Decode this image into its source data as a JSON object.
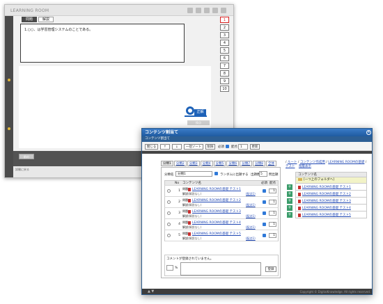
{
  "background_window": {
    "logo": "LEARNING ROOM",
    "tabs": [
      {
        "label": "問題"
      },
      {
        "label": "解説"
      }
    ],
    "question_text": "1.○○、は学習管理システムのことである。",
    "numbers": [
      "1",
      "2",
      "3",
      "4",
      "5",
      "6",
      "7",
      "8",
      "9",
      "10"
    ],
    "answer_label": "正解",
    "mark_label": "採点",
    "next_label": "正一",
    "prev_button": "前の",
    "status_text": "試験に戻る"
  },
  "dialog": {
    "title": "コンテンツ割当て",
    "subtitle": "コンテンツ割当て",
    "close": "×",
    "toolbar": {
      "save": "閉じる",
      "up": "↑",
      "down": "↓",
      "batch_sort": "一括ソート",
      "delete": "削除",
      "required_label": "必須",
      "score_label": "配点",
      "score_value": "1",
      "apply": "更新"
    },
    "tabs": [
      "分類1",
      "分類2",
      "分類3",
      "分類4",
      "分類5",
      "分類6",
      "分類7",
      "分類8",
      "全体"
    ],
    "controls": {
      "name_label": "分類名",
      "name_value": "分類1",
      "random_label": "ランダムに出題する",
      "count_label": "出題数",
      "count_value": "5",
      "count_suffix": "問出題"
    },
    "table": {
      "headers": {
        "no": "No",
        "contents": "コンテンツ名",
        "required": "必須",
        "score": "配点"
      },
      "rows": [
        {
          "no": "1",
          "q_badge": "問題",
          "k_badge": "解説",
          "title": "LEARNING ROOMの基礎 テスト1",
          "none": "(解説なし)",
          "edit": "(配点1)",
          "score": "1"
        },
        {
          "no": "2",
          "q_badge": "問題",
          "k_badge": "解説",
          "title": "LEARNING ROOMの基礎 テスト2",
          "none": "(解説なし)",
          "edit": "(配点1)",
          "score": "1"
        },
        {
          "no": "3",
          "q_badge": "問題",
          "k_badge": "解説",
          "title": "LEARNING ROOMの基礎 テスト3",
          "none": "(解説なし)",
          "edit": "(配点1)",
          "score": "1"
        },
        {
          "no": "4",
          "q_badge": "問題",
          "k_badge": "解説",
          "title": "LEARNING ROOMの基礎 テスト4",
          "none": "(解説なし)",
          "edit": "(配点1)",
          "score": "1"
        },
        {
          "no": "5",
          "q_badge": "問題",
          "k_badge": "解説",
          "title": "LEARNING ROOMの基礎 テスト5",
          "none": "(解説なし)",
          "edit": "(配点1)",
          "score": "1"
        }
      ]
    },
    "comment": {
      "status": "コメントが登録されていません。",
      "percent_label": "%",
      "register": "登録"
    },
    "breadcrumb": {
      "items": [
        "ルート",
        "コンテンツ作成用",
        "LEARNING ROOMの基礎",
        "テスト"
      ],
      "side_link": "階層表示"
    },
    "tree": {
      "header": "コンテンツ名",
      "up_label": "[一つ上のフォルダへ]",
      "items": [
        "LEARNING ROOMの基礎 テスト1",
        "LEARNING ROOMの基礎 テスト2",
        "LEARNING ROOMの基礎 テスト3",
        "LEARNING ROOMの基礎 テスト4",
        "LEARNING ROOMの基礎 テスト5"
      ]
    },
    "footer": {
      "copyright": "Copyright © DigitalKnowledge. All rights reserved.",
      "arrows": "▲ ▼"
    }
  }
}
